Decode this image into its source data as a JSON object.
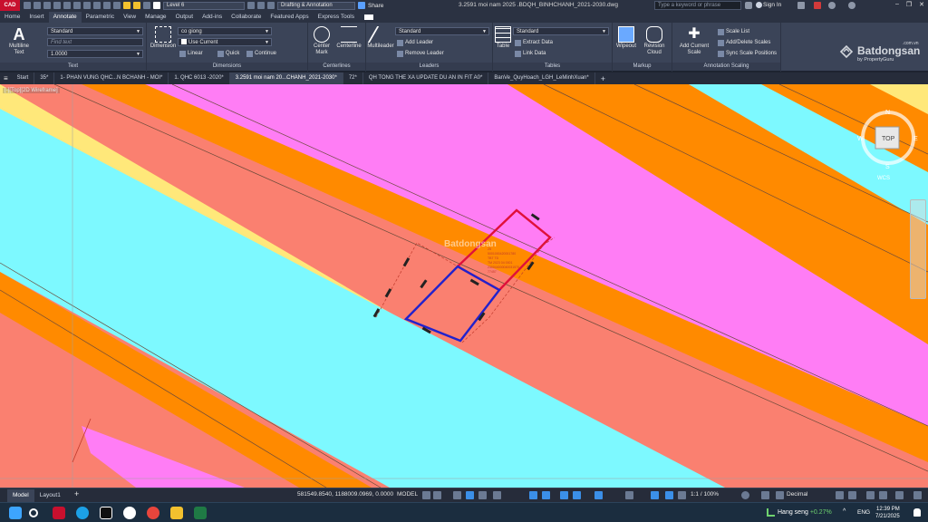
{
  "app": {
    "logo_text": "CAD",
    "layer_dropdown": "Level 6",
    "workspace_dropdown": "Drafting & Annotation",
    "share_label": "Share",
    "document_title": "3.2591 moi nam 2025 .BDQH_BINHCHANH_2021-2030.dwg",
    "search_placeholder": "Type a keyword or phrase",
    "signin_label": "Sign In"
  },
  "menu_tabs": [
    "Home",
    "Insert",
    "Annotate",
    "Parametric",
    "View",
    "Manage",
    "Output",
    "Add-ins",
    "Collaborate",
    "Featured Apps",
    "Express Tools"
  ],
  "active_menu_tab": "Annotate",
  "ribbon": {
    "text_panel": {
      "label": "Text",
      "big_button": "Multiline Text",
      "style_value": "Standard",
      "find_placeholder": "Find text",
      "height_value": "1.0000"
    },
    "dimensions_panel": {
      "label": "Dimensions",
      "big_button": "Dimension",
      "dimstyle_value": "co giong",
      "layer_value": "Use Current",
      "linear_label": "Linear",
      "quick_label": "Quick",
      "continue_label": "Continue"
    },
    "centerlines_panel": {
      "label": "Centerlines",
      "center_mark": "Center Mark",
      "centerline": "Centerline"
    },
    "leaders_panel": {
      "label": "Leaders",
      "big_button": "Multileader",
      "style_value": "Standard",
      "add_leader": "Add Leader",
      "remove_leader": "Remove Leader"
    },
    "tables_panel": {
      "label": "Tables",
      "big_button": "Table",
      "style_value": "Standard",
      "extract_data": "Extract Data",
      "link_data": "Link Data"
    },
    "markup_panel": {
      "label": "Markup",
      "wipeout": "Wipeout",
      "revision_cloud": "Revision Cloud"
    },
    "annotation_scaling_panel": {
      "label": "Annotation Scaling",
      "add_current_scale": "Add Current Scale",
      "scale_list": "Scale List",
      "add_delete_scales": "Add/Delete Scales",
      "sync_scale_positions": "Sync Scale Positions"
    }
  },
  "watermark": {
    "name": "Batdongsan",
    "domain": ".com.vn",
    "sub": "by PropertyGuru"
  },
  "doc_tabs": [
    "Start",
    "35*",
    "1- PHAN VUNG QHC...N BCHANH - MOI*",
    "1. QHC 6013 -2020*",
    "3.2591 moi nam 20...CHANH_2021-2030*",
    "72*",
    "QH TONG THE XA UPDATE DU AN IN FIT A0*",
    "BanVe_QuyHoach_LGH_LeMinhXuan*"
  ],
  "active_doc_tab": 4,
  "viewport_label": "[-][Top][2D Wireframe]",
  "viewcube": {
    "face": "TOP",
    "north": "N",
    "west": "W",
    "east": "E",
    "south": "S",
    "ucs": "WCS"
  },
  "drawing_text": {
    "plot_lines": [
      "25",
      "5001000420001780",
      "TBT TD",
      "TM 2023 04 0001",
      "230044000040031570",
      "77457"
    ],
    "watermark": "Batdongsan"
  },
  "colors": {
    "magenta": "#ff7df5",
    "orange": "#ff8a00",
    "salmon": "#fa8070",
    "cyan": "#7df9ff",
    "pale_yellow": "#ffe87a",
    "highlight_red": "#e0103a",
    "highlight_blue": "#2222cc"
  },
  "status": {
    "layout_tabs": [
      "Model",
      "Layout1"
    ],
    "active_layout": "Model",
    "coordinates": "581549.8540, 1188009.0969, 0.0000",
    "space": "MODEL",
    "scale": "1:1 / 100%",
    "units": "Decimal"
  },
  "taskbar": {
    "stock_name": "Hang seng",
    "stock_change": "+0.27%",
    "language": "ENG",
    "time": "12:39 PM",
    "date": "7/21/2025"
  }
}
